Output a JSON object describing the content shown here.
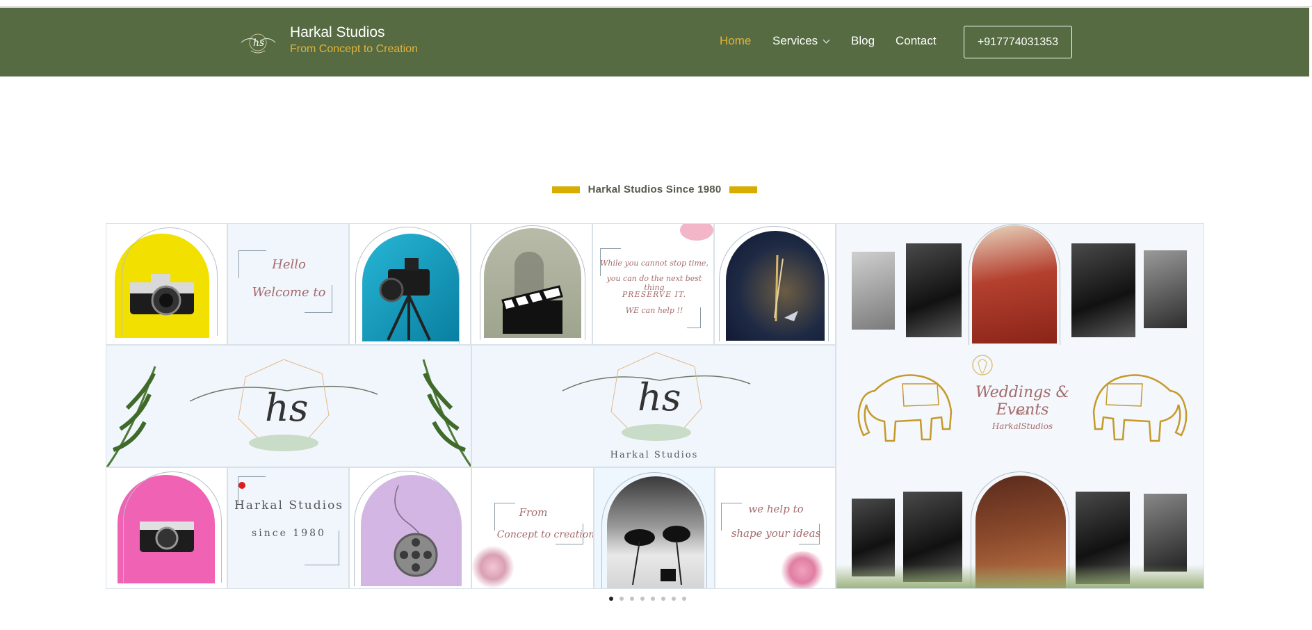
{
  "brand": {
    "name": "Harkal Studios",
    "tagline": "From Concept to Creation",
    "logo_icon": "hs-monogram-icon"
  },
  "nav": {
    "items": [
      {
        "label": "Home",
        "active": true
      },
      {
        "label": "Services",
        "dropdown": true
      },
      {
        "label": "Blog"
      },
      {
        "label": "Contact"
      }
    ],
    "phone": "+917774031353"
  },
  "hero": {
    "heading": "Harkal Studios Since 1980",
    "accent_color": "#d6ad00",
    "header_color": "#566b42",
    "highlight_color": "#e3b23c"
  },
  "slide": {
    "hello": [
      "Hello",
      "Welcome to"
    ],
    "quote": [
      "While you cannot stop time,",
      "you can do the next best thing",
      "PRESERVE IT.",
      "WE can help !!"
    ],
    "monogram": "hs",
    "monogram_caption": "Harkal Studios",
    "studio_name": "Harkal Studios",
    "since": "since 1980",
    "from": [
      "From",
      "Concept to creation"
    ],
    "help": [
      "we help to",
      "shape your ideas"
    ],
    "weddings_title": "Weddings & Events",
    "weddings_with": "with",
    "weddings_brand": "HarkalStudios"
  },
  "carousel": {
    "count": 8,
    "active": 0
  }
}
